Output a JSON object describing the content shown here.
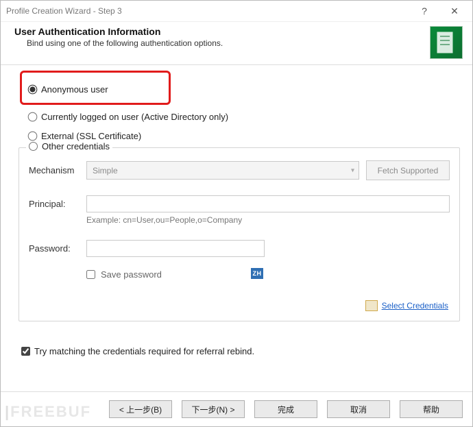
{
  "titlebar": {
    "title": "Profile Creation Wizard - Step 3",
    "help_glyph": "?",
    "close_glyph": "✕"
  },
  "header": {
    "title": "User Authentication Information",
    "subtitle": "Bind using one of the following authentication options."
  },
  "options": {
    "anonymous": "Anonymous user",
    "current": "Currently logged on user (Active Directory only)",
    "external": "External (SSL Certificate)",
    "other": "Other credentials"
  },
  "form": {
    "mechanism_label": "Mechanism",
    "mechanism_value": "Simple",
    "fetch_supported": "Fetch Supported",
    "principal_label": "Principal:",
    "principal_hint": "Example: cn=User,ou=People,o=Company",
    "password_label": "Password:",
    "save_password": "Save password",
    "ime_text": "ZH",
    "select_credentials": "Select Credentials"
  },
  "checkbox": {
    "referral": "Try matching the credentials required for referral rebind."
  },
  "footer": {
    "back": "< 上一步(B)",
    "next": "下一步(N) >",
    "finish": "完成",
    "cancel": "取消",
    "help": "帮助"
  },
  "watermark": {
    "text": "FREEBUF"
  }
}
